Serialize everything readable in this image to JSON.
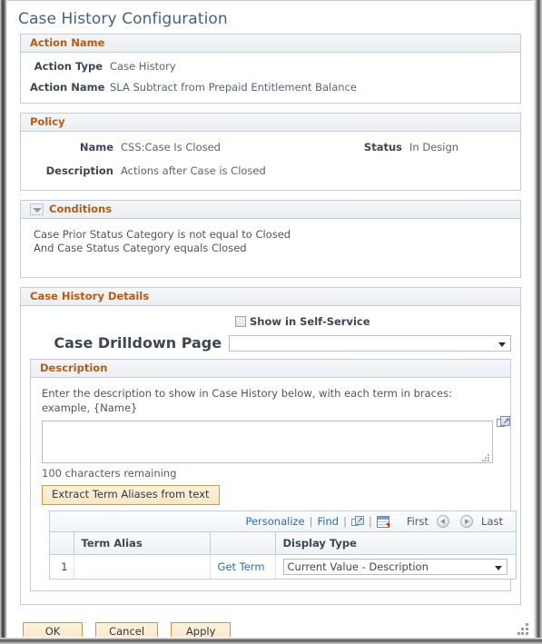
{
  "page": {
    "title": "Case History Configuration"
  },
  "action_name_section": {
    "header": "Action Name",
    "fields": [
      {
        "label": "Action Type",
        "value": "Case History"
      },
      {
        "label": "Action Name",
        "value": "SLA Subtract from Prepaid Entitlement Balance"
      }
    ]
  },
  "policy_section": {
    "header": "Policy",
    "name_label": "Name",
    "name_value": "CSS:Case Is Closed",
    "status_label": "Status",
    "status_value": "In Design",
    "description_label": "Description",
    "description_value": "Actions after Case is Closed"
  },
  "conditions_section": {
    "header": "Conditions",
    "toggle_icon": "collapse-triangle-icon",
    "lines": [
      "Case Prior Status Category is not equal to Closed",
      "And Case Status Category equals Closed"
    ]
  },
  "case_history_details": {
    "header": "Case History Details",
    "show_in_self_service_label": "Show in Self-Service",
    "show_in_self_service_checked": false,
    "drilldown_label": "Case Drilldown Page",
    "drilldown_value": "",
    "description_group": {
      "header": "Description",
      "instructions": "Enter the description to show in Case History below, with each term in braces: example, {Name}",
      "textarea_value": "",
      "expand_icon": "expand-popup-icon",
      "chars_remaining": "100 characters remaining",
      "extract_button": "Extract Term Aliases from text"
    },
    "grid": {
      "toolbar": {
        "personalize": "Personalize",
        "find": "Find",
        "separator": "|",
        "view_all_icon": "expand-popup-icon",
        "download_icon": "download-to-spreadsheet-icon",
        "first": "First",
        "prev_icon": "previous-page-icon",
        "next_icon": "next-page-icon",
        "last": "Last"
      },
      "columns": [
        "",
        "Term Alias",
        "",
        "Display Type"
      ],
      "rows": [
        {
          "num": "1",
          "term_alias": "",
          "get_term_link": "Get Term",
          "display_type": "Current Value - Description"
        }
      ]
    }
  },
  "footer_buttons": {
    "ok": "OK",
    "cancel": "Cancel",
    "apply": "Apply"
  },
  "colors": {
    "title": "#4a6179",
    "section_header": "#b35c17",
    "link": "#2b6eb5",
    "button_border": "#c79a4e",
    "button_bg": "#fae6c4"
  }
}
